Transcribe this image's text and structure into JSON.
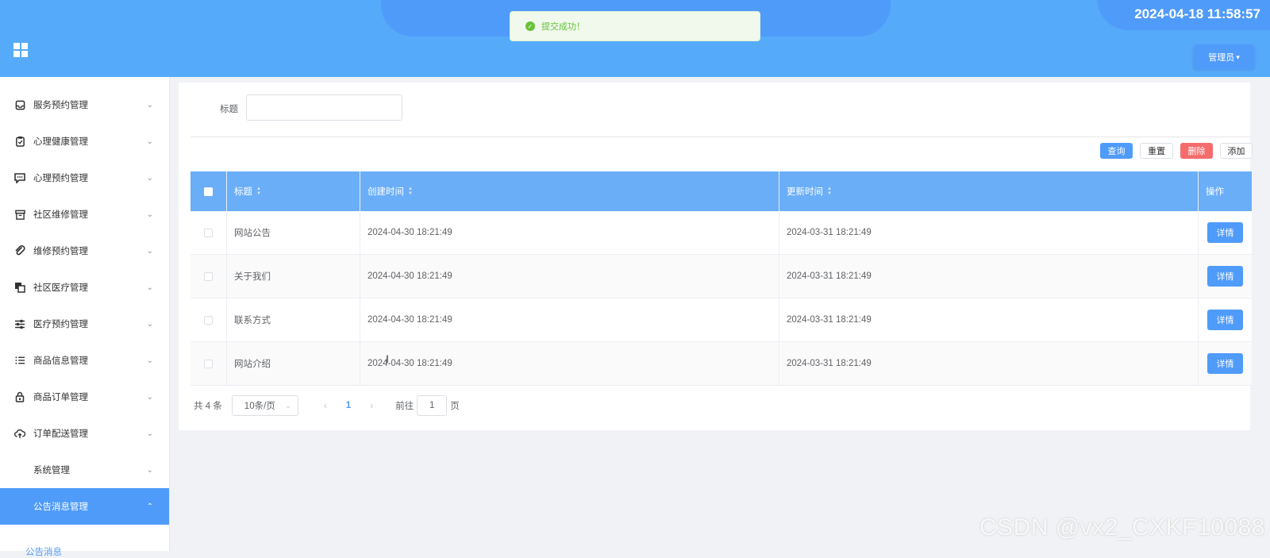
{
  "header": {
    "datetime": "2024-04-18 11:58:57",
    "admin_label": "管理员"
  },
  "toast": {
    "message": "提交成功！",
    "status_color": "#67c23a"
  },
  "colors": {
    "primary": "#4f9bfa",
    "danger": "#f56c6c",
    "header_bg": "#55abf9"
  },
  "sidebar": {
    "items": [
      {
        "label": "服务预约管理",
        "icon": "inbox-icon"
      },
      {
        "label": "心理健康管理",
        "icon": "clipboard-check-icon"
      },
      {
        "label": "心理预约管理",
        "icon": "chat-icon"
      },
      {
        "label": "社区维修管理",
        "icon": "archive-icon"
      },
      {
        "label": "维修预约管理",
        "icon": "paperclip-icon"
      },
      {
        "label": "社区医疗管理",
        "icon": "copy-icon"
      },
      {
        "label": "医疗预约管理",
        "icon": "sliders-icon"
      },
      {
        "label": "商品信息管理",
        "icon": "list-icon"
      },
      {
        "label": "商品订单管理",
        "icon": "lock-icon"
      },
      {
        "label": "订单配送管理",
        "icon": "cloud-upload-icon"
      },
      {
        "label": "系统管理",
        "icon": ""
      },
      {
        "label": "公告消息管理",
        "icon": ""
      }
    ],
    "submenu_label": "公告消息"
  },
  "search": {
    "label": "标题",
    "value": ""
  },
  "toolbar": {
    "query": "查询",
    "reset": "重置",
    "delete": "删除",
    "add": "添加"
  },
  "table": {
    "columns": [
      "标题",
      "创建时间",
      "更新时间",
      "操作"
    ],
    "rows": [
      {
        "title": "网站公告",
        "created": "2024-04-30 18:21:49",
        "updated": "2024-03-31 18:21:49",
        "action": "详情"
      },
      {
        "title": "关于我们",
        "created": "2024-04-30 18:21:49",
        "updated": "2024-03-31 18:21:49",
        "action": "详情"
      },
      {
        "title": "联系方式",
        "created": "2024-04-30 18:21:49",
        "updated": "2024-03-31 18:21:49",
        "action": "详情"
      },
      {
        "title": "网站介绍",
        "created": "2024-04-30 18:21:49",
        "updated": "2024-03-31 18:21:49",
        "action": "详情"
      }
    ]
  },
  "pagination": {
    "total": "共 4 条",
    "page_size": "10条/页",
    "current_page": "1",
    "goto_label": "前往",
    "goto_value": "1",
    "page_suffix": "页"
  },
  "watermark": "CSDN @vx2_CXKF10088"
}
